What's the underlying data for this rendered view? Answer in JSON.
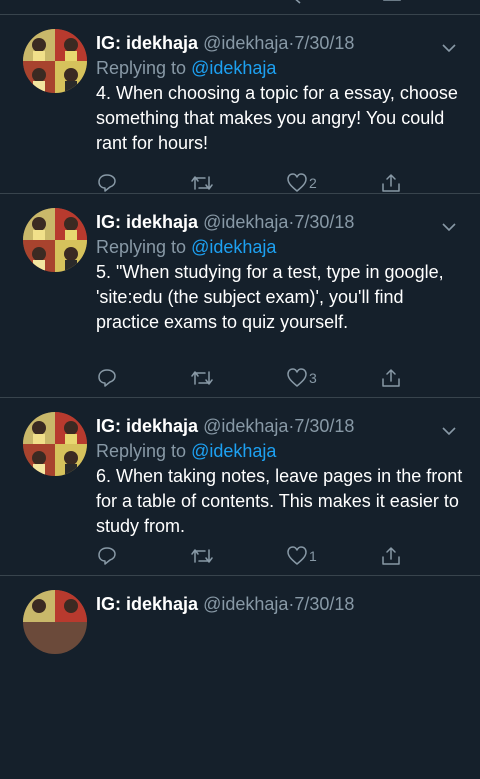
{
  "tweets": [
    {
      "display_name": "IG: idekhaja",
      "handle": "@idekhaja",
      "separator": "·",
      "date": "7/30/18",
      "replying_prefix": "Replying to",
      "replying_handle": "@idekhaja",
      "text": "4. When choosing a topic for a essay, choose something that makes you angry! You could rant for hours!",
      "likes": "2"
    },
    {
      "display_name": "IG: idekhaja",
      "handle": "@idekhaja",
      "separator": "·",
      "date": "7/30/18",
      "replying_prefix": "Replying to",
      "replying_handle": "@idekhaja",
      "text": "5. \"When studying for a test, type in google, 'site:edu (the subject exam)', you'll find practice exams to quiz yourself.",
      "likes": "3"
    },
    {
      "display_name": "IG: idekhaja",
      "handle": "@idekhaja",
      "separator": "·",
      "date": "7/30/18",
      "replying_prefix": "Replying to",
      "replying_handle": "@idekhaja",
      "text": "6. When taking notes, leave pages in the front for a table of contents. This makes it easier to study from.",
      "likes": "1"
    },
    {
      "display_name": "IG: idekhaja",
      "handle": "@idekhaja",
      "separator": "·",
      "date": "7/30/18"
    }
  ],
  "icons": {
    "reply": "reply-icon",
    "retweet": "retweet-icon",
    "like": "heart-icon",
    "share": "share-icon",
    "more": "chevron-down-icon"
  },
  "colors": {
    "background": "#15202b",
    "divider": "#38444d",
    "text": "#ffffff",
    "muted": "#8899a6",
    "link": "#1da1f2"
  }
}
